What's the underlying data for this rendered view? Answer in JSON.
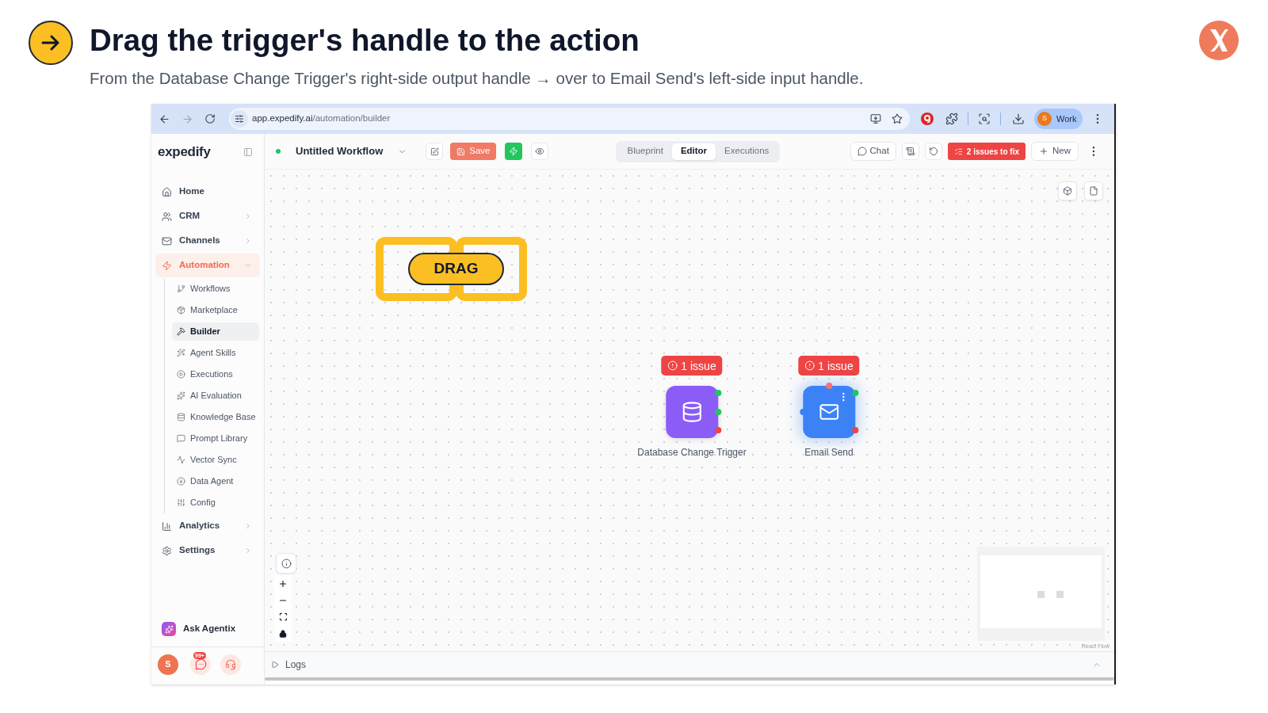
{
  "slide": {
    "title": "Drag the trigger's handle to the action",
    "subtitle": "From the Database Change Trigger's right-side output handle → over to Email Send's left-side input handle."
  },
  "browser": {
    "url_host": "app.expedify.ai",
    "url_path": "/automation/builder",
    "profile": {
      "initial": "S",
      "label": "Work"
    }
  },
  "app": {
    "logo": "expedify",
    "sidebar": {
      "items": [
        {
          "label": "Home",
          "kind": "link",
          "selected": false
        },
        {
          "label": "CRM",
          "kind": "group",
          "selected": false,
          "expanded": false
        },
        {
          "label": "Channels",
          "kind": "group",
          "selected": false,
          "expanded": false
        },
        {
          "label": "Automation",
          "kind": "group",
          "selected": true,
          "expanded": true,
          "children": [
            {
              "label": "Workflows",
              "selected": false
            },
            {
              "label": "Marketplace",
              "selected": false
            },
            {
              "label": "Builder",
              "selected": true
            },
            {
              "label": "Agent Skills",
              "selected": false
            },
            {
              "label": "Executions",
              "selected": false
            },
            {
              "label": "AI Evaluation",
              "selected": false
            },
            {
              "label": "Knowledge Base",
              "selected": false
            },
            {
              "label": "Prompt Library",
              "selected": false
            },
            {
              "label": "Vector Sync",
              "selected": false
            },
            {
              "label": "Data Agent",
              "selected": false
            },
            {
              "label": "Config",
              "selected": false
            }
          ]
        },
        {
          "label": "Analytics",
          "kind": "group",
          "selected": false,
          "expanded": false
        },
        {
          "label": "Settings",
          "kind": "group",
          "selected": false,
          "expanded": false
        }
      ],
      "assistant": "Ask Agentix",
      "user_initial": "S",
      "notification_count": "99+"
    },
    "toolbar": {
      "workflow_name": "Untitled Workflow",
      "save_label": "Save",
      "tabs": [
        {
          "label": "Blueprint",
          "selected": false
        },
        {
          "label": "Editor",
          "selected": true
        },
        {
          "label": "Executions",
          "selected": false
        }
      ],
      "chat_label": "Chat",
      "issues_label": "2 issues to fix",
      "new_label": "New"
    },
    "canvas": {
      "hint": "DRAG",
      "nodes": [
        {
          "kind": "trigger",
          "label": "Database Change Trigger",
          "issue": "1 issue",
          "color": "#8b5cf6",
          "selected": false
        },
        {
          "kind": "action",
          "label": "Email Send",
          "issue": "1 issue",
          "color": "#3b82f6",
          "selected": true
        }
      ],
      "attribution": "React Flow"
    },
    "logs_label": "Logs"
  }
}
